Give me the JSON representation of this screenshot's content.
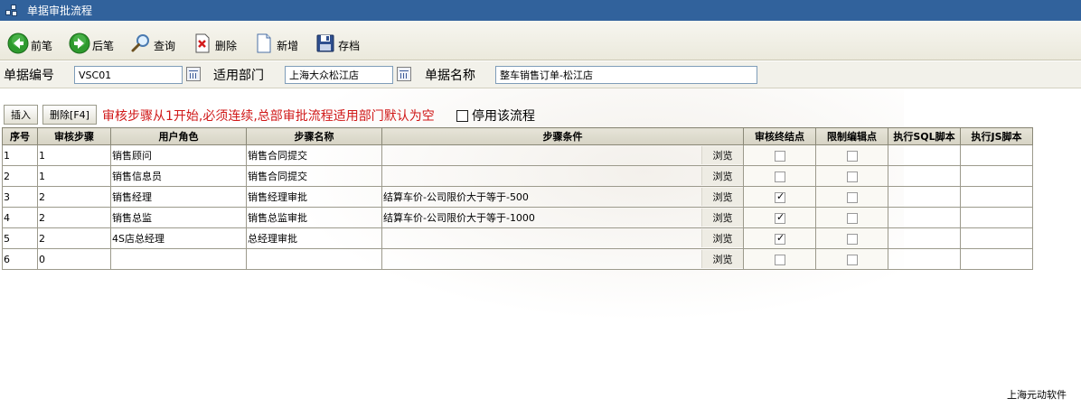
{
  "window": {
    "title": "单据审批流程"
  },
  "toolbar": {
    "buttons": [
      {
        "label": "前笔",
        "icon": "arrow-left-icon"
      },
      {
        "label": "后笔",
        "icon": "arrow-right-icon"
      },
      {
        "label": "查询",
        "icon": "search-icon"
      },
      {
        "label": "删除",
        "icon": "delete-icon"
      },
      {
        "label": "新增",
        "icon": "new-document-icon"
      },
      {
        "label": "存档",
        "icon": "save-icon"
      }
    ]
  },
  "form": {
    "doc_no_label": "单据编号",
    "doc_no_value": "VSC01",
    "dept_label": "适用部门",
    "dept_value": "上海大众松江店",
    "doc_name_label": "单据名称",
    "doc_name_value": "整车销售订单-松江店"
  },
  "actions": {
    "insert_label": "插入",
    "delete_label": "删除[F4]",
    "notice": "审核步骤从1开始,必须连续,总部审批流程适用部门默认为空",
    "disable_label": "停用该流程",
    "disable_checked": false
  },
  "table": {
    "columns": [
      "序号",
      "审核步骤",
      "用户角色",
      "步骤名称",
      "步骤条件",
      "审核终结点",
      "限制编辑点",
      "执行SQL脚本",
      "执行JS脚本"
    ],
    "browse_label": "浏览",
    "rows": [
      {
        "seq": "1",
        "step": "1",
        "role": "销售顾问",
        "name": "销售合同提交",
        "cond": "",
        "final": false,
        "restrict": false,
        "sql": "",
        "js": ""
      },
      {
        "seq": "2",
        "step": "1",
        "role": "销售信息员",
        "name": "销售合同提交",
        "cond": "",
        "final": false,
        "restrict": false,
        "sql": "",
        "js": ""
      },
      {
        "seq": "3",
        "step": "2",
        "role": "销售经理",
        "name": "销售经理审批",
        "cond": "结算车价-公司限价大于等于-500",
        "final": true,
        "restrict": false,
        "sql": "",
        "js": ""
      },
      {
        "seq": "4",
        "step": "2",
        "role": "销售总监",
        "name": "销售总监审批",
        "cond": "结算车价-公司限价大于等于-1000",
        "final": true,
        "restrict": false,
        "sql": "",
        "js": ""
      },
      {
        "seq": "5",
        "step": "2",
        "role": "4S店总经理",
        "name": "总经理审批",
        "cond": "",
        "final": true,
        "restrict": false,
        "sql": "",
        "js": ""
      },
      {
        "seq": "6",
        "step": "0",
        "role": "",
        "name": "",
        "cond": "",
        "final": false,
        "restrict": false,
        "sql": "",
        "js": ""
      }
    ]
  },
  "footer": {
    "company": "上海元动软件"
  }
}
